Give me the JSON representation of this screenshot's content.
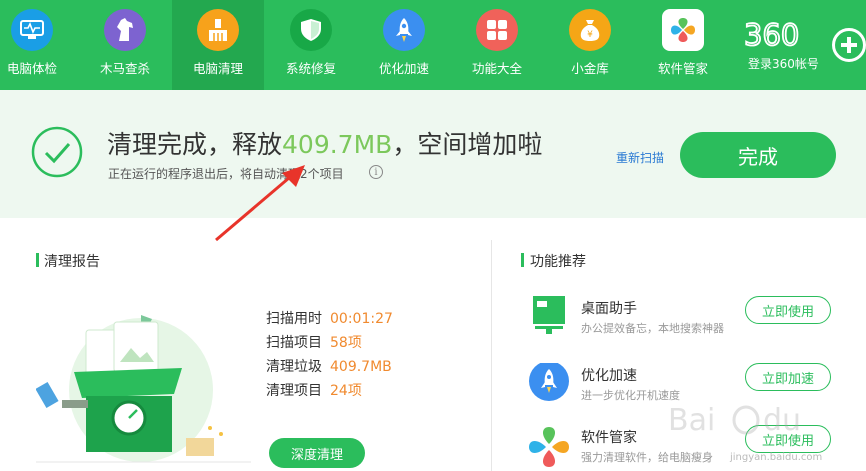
{
  "nav": {
    "items": [
      {
        "label": "电脑体检",
        "icon": "monitor-pulse-icon",
        "color": "#1a9ee6",
        "active": false
      },
      {
        "label": "木马查杀",
        "icon": "horse-icon",
        "color": "#7d63d0",
        "active": false
      },
      {
        "label": "电脑清理",
        "icon": "broom-icon",
        "color": "#f7a21b",
        "active": true
      },
      {
        "label": "系统修复",
        "icon": "shield-icon",
        "color": "#18a847",
        "active": false
      },
      {
        "label": "优化加速",
        "icon": "rocket-icon",
        "color": "#3b8ff0",
        "active": false
      },
      {
        "label": "功能大全",
        "icon": "grid-icon",
        "color": "#f0625a",
        "active": false
      },
      {
        "label": "小金库",
        "icon": "money-bag-icon",
        "color": "#f5a616",
        "active": false
      },
      {
        "label": "软件管家",
        "icon": "app-store-icon",
        "color": "#ffffff",
        "active": false
      }
    ],
    "brand": "360",
    "account_label": "登录360帐号"
  },
  "result": {
    "title_before": "清理完成，释放",
    "title_highlight": "409.7MB",
    "title_after": "，空间增加啦",
    "subtitle": "正在运行的程序退出后，将自动清理2个项目",
    "info": "i",
    "rescan": "重新扫描",
    "done": "完成"
  },
  "report": {
    "title": "清理报告",
    "stats": [
      {
        "label": "扫描用时",
        "value": "00:01:27"
      },
      {
        "label": "扫描项目",
        "value": "58项"
      },
      {
        "label": "清理垃圾",
        "value": "409.7MB"
      },
      {
        "label": "清理项目",
        "value": "24项"
      }
    ],
    "deep_clean": "深度清理"
  },
  "recommend": {
    "title": "功能推荐",
    "items": [
      {
        "name": "桌面助手",
        "desc": "办公提效备忘，本地搜索神器",
        "button": "立即使用",
        "icon": "desktop-assistant-icon"
      },
      {
        "name": "优化加速",
        "desc": "进一步优化开机速度",
        "button": "立即加速",
        "icon": "rocket-icon"
      },
      {
        "name": "软件管家",
        "desc": "强力清理软件，给电脑瘦身",
        "button": "立即使用",
        "icon": "app-store-icon"
      }
    ]
  },
  "watermark": "jingyan.baidu.com",
  "colors": {
    "brand_green": "#2bbd5c",
    "highlight_green": "#7cc85c",
    "stat_orange": "#f08a2f",
    "link_blue": "#2a7ad3"
  }
}
